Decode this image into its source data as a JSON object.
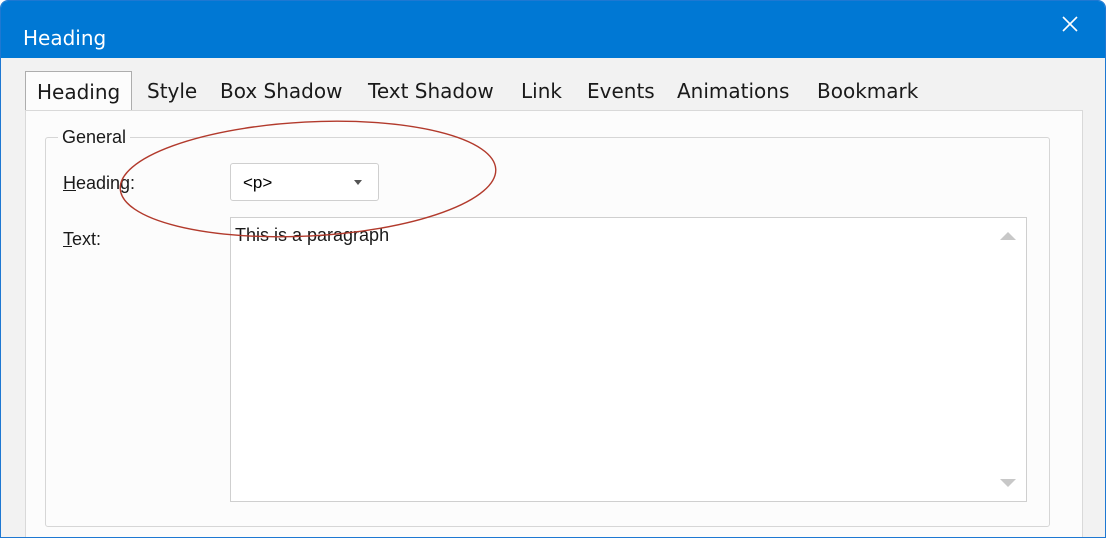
{
  "window": {
    "title": "Heading",
    "title_bar_color": "#0078d4",
    "close_icon": "close-icon"
  },
  "tabs": [
    {
      "label": "Heading",
      "active": true
    },
    {
      "label": "Style",
      "active": false
    },
    {
      "label": "Box Shadow",
      "active": false
    },
    {
      "label": "Text Shadow",
      "active": false
    },
    {
      "label": "Link",
      "active": false
    },
    {
      "label": "Events",
      "active": false
    },
    {
      "label": "Animations",
      "active": false
    },
    {
      "label": "Bookmark",
      "active": false
    }
  ],
  "general": {
    "legend": "General",
    "heading_label_mnemonic": "H",
    "heading_label_rest": "eading:",
    "heading_value": "<p>",
    "text_label_mnemonic": "T",
    "text_label_rest": "ext:",
    "text_value": "This is a paragraph"
  },
  "annotation": {
    "shape": "ellipse",
    "color": "#b23a2c"
  }
}
